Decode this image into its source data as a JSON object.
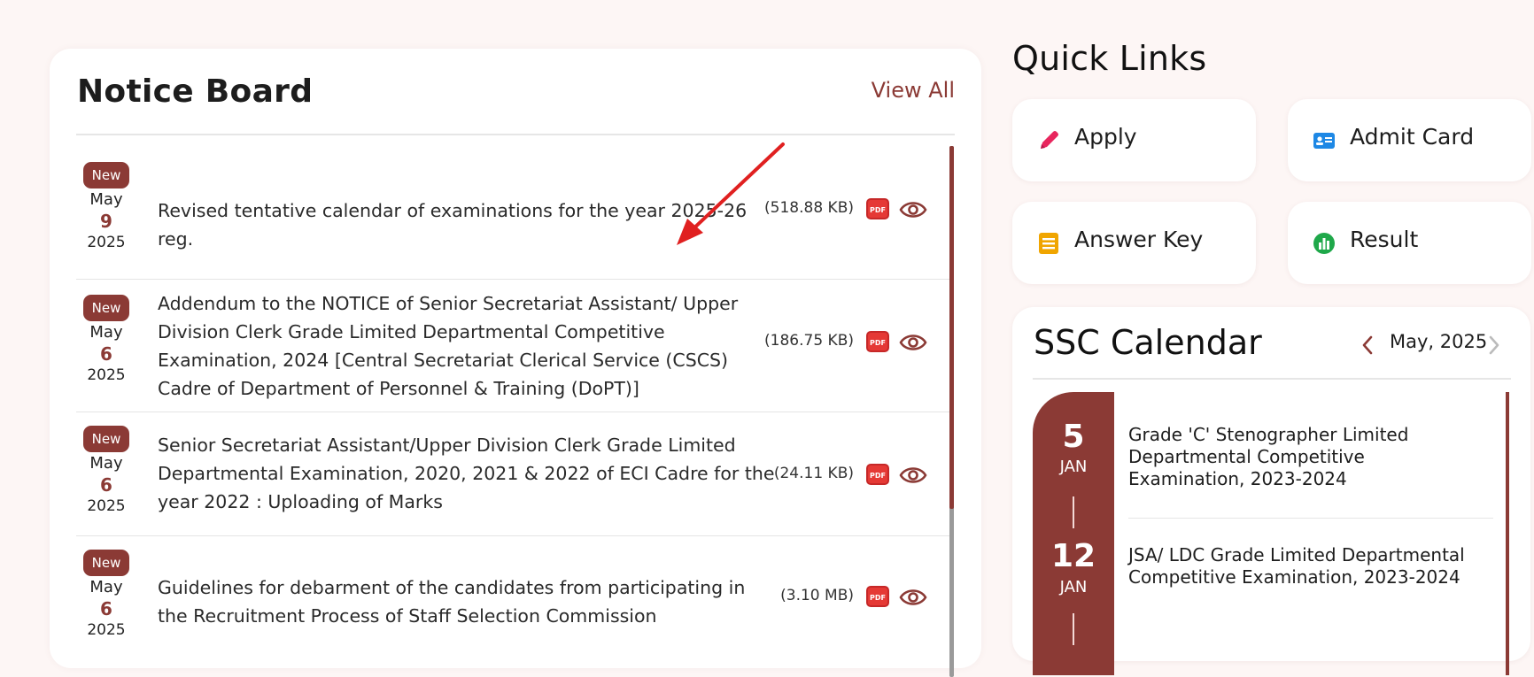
{
  "notice_board": {
    "title": "Notice Board",
    "view_all": "View All",
    "notices": [
      {
        "badge": "New",
        "month": "May",
        "day": "9",
        "year": "2025",
        "text": "Revised tentative calendar of examinations for the year 2025-26 reg.",
        "size": "(518.88 KB)"
      },
      {
        "badge": "New",
        "month": "May",
        "day": "6",
        "year": "2025",
        "text": "Addendum to the NOTICE of Senior Secretariat Assistant/ Upper Division Clerk Grade Limited Departmental Competitive Examination, 2024 [Central Secretariat Clerical Service (CSCS) Cadre of Department of Personnel & Training (DoPT)]",
        "size": "(186.75 KB)"
      },
      {
        "badge": "New",
        "month": "May",
        "day": "6",
        "year": "2025",
        "text": "Senior Secretariat Assistant/Upper Division Clerk Grade Limited Departmental Examination, 2020, 2021 & 2022 of ECI Cadre for the year 2022 : Uploading of Marks",
        "size": "(24.11 KB)"
      },
      {
        "badge": "New",
        "month": "May",
        "day": "6",
        "year": "2025",
        "text": "Guidelines for debarment of the candidates from participating in the Recruitment Process of Staff Selection Commission",
        "size": "(3.10 MB)"
      }
    ],
    "pdf_icon_label": "PDF"
  },
  "quick_links": {
    "title": "Quick Links",
    "items": [
      {
        "label": "Apply",
        "icon": "pencil-icon",
        "color": "#e8265e"
      },
      {
        "label": "Admit Card",
        "icon": "id-card-icon",
        "color": "#1e88e5"
      },
      {
        "label": "Answer Key",
        "icon": "list-icon",
        "color": "#f0a500"
      },
      {
        "label": "Result",
        "icon": "bar-chart-icon",
        "color": "#1fa84a"
      }
    ]
  },
  "ssc_calendar": {
    "title": "SSC Calendar",
    "month_label": "May, 2025",
    "events": [
      {
        "day": "5",
        "month": "JAN",
        "text": "Grade 'C' Stenographer Limited Departmental Competitive Examination, 2023-2024"
      },
      {
        "day": "12",
        "month": "JAN",
        "text": "JSA/ LDC Grade Limited Departmental Competitive Examination, 2023-2024"
      }
    ]
  },
  "colors": {
    "accent": "#8b3a35",
    "background": "#fdf6f5"
  }
}
